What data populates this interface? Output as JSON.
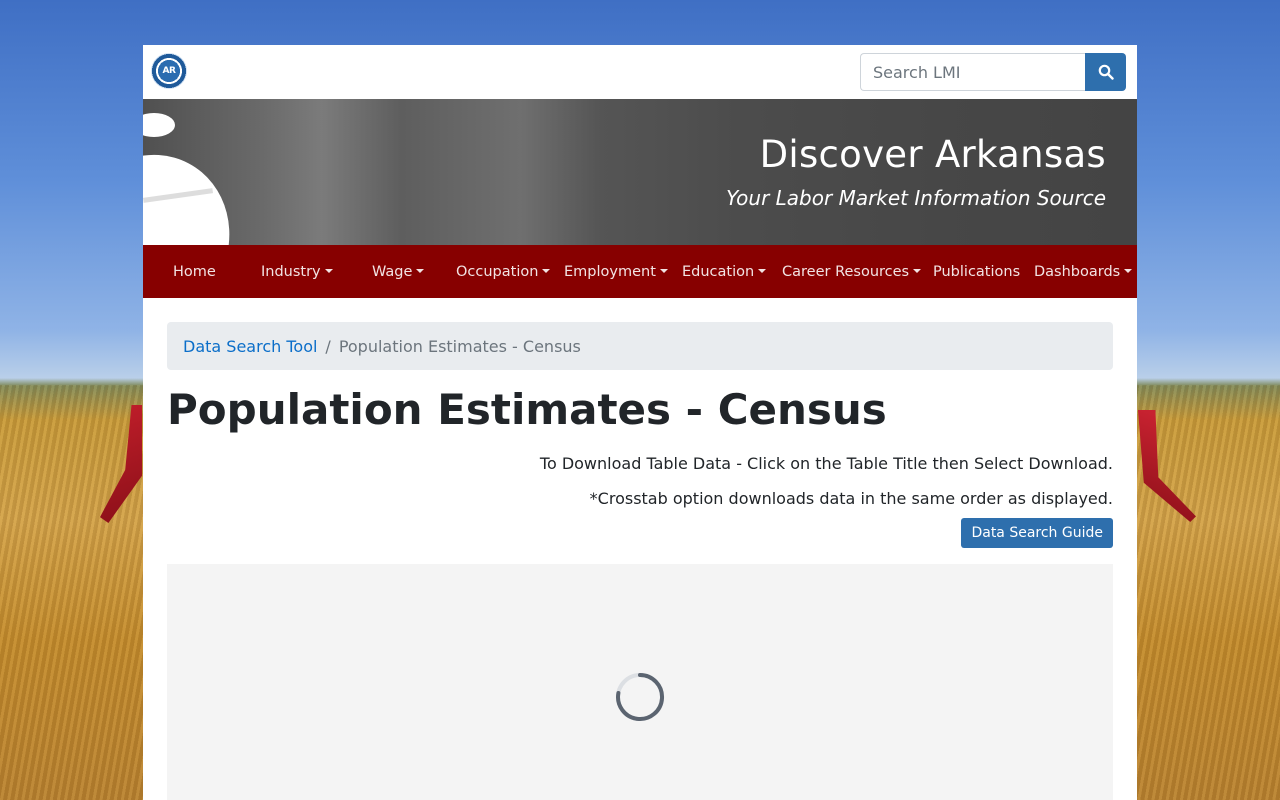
{
  "header": {
    "logo_text": "AR",
    "search": {
      "placeholder": "Search LMI",
      "value": "",
      "button_icon": "search-icon"
    }
  },
  "banner": {
    "title": "Discover Arkansas",
    "subtitle": "Your Labor Market Information Source"
  },
  "nav": {
    "items": [
      {
        "label": "Home",
        "dropdown": false
      },
      {
        "label": "Industry",
        "dropdown": true
      },
      {
        "label": "Wage",
        "dropdown": true
      },
      {
        "label": "Occupation",
        "dropdown": true
      },
      {
        "label": "Employment",
        "dropdown": true
      },
      {
        "label": "Education",
        "dropdown": true
      },
      {
        "label": "Career Resources",
        "dropdown": true
      },
      {
        "label": "Publications",
        "dropdown": false
      },
      {
        "label": "Dashboards",
        "dropdown": true
      }
    ]
  },
  "breadcrumb": {
    "link": "Data Search Tool",
    "separator": "/",
    "current": "Population Estimates - Census"
  },
  "main": {
    "title": "Population Estimates - Census",
    "note1": "To Download Table Data - Click on the Table Title then Select Download.",
    "note2": "*Crosstab option downloads data in the same order as displayed.",
    "guide_button": "Data Search Guide"
  },
  "colors": {
    "nav_bg": "#870000",
    "accent_blue": "#2e6fad",
    "link_blue": "#0b6ec9"
  }
}
